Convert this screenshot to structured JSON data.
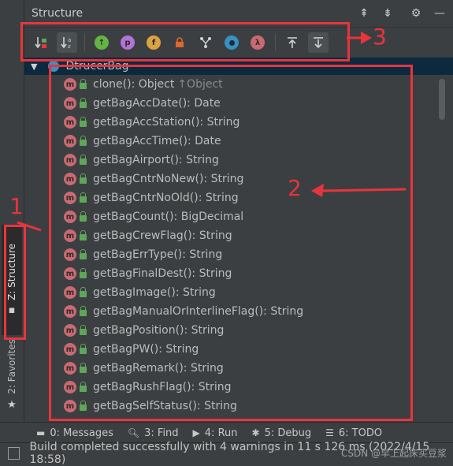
{
  "panel": {
    "title": "Structure",
    "root_label": "DtrucerBag"
  },
  "left_tabs": {
    "structure": "Z: Structure",
    "favorites": "2: Favorites"
  },
  "members": [
    {
      "name": "clone(): Object",
      "inherited": "↑Object"
    },
    {
      "name": "getBagAccDate(): Date"
    },
    {
      "name": "getBagAccStation(): String"
    },
    {
      "name": "getBagAccTime(): Date"
    },
    {
      "name": "getBagAirport(): String"
    },
    {
      "name": "getBagCntrNoNew(): String"
    },
    {
      "name": "getBagCntrNoOld(): String"
    },
    {
      "name": "getBagCount(): BigDecimal"
    },
    {
      "name": "getBagCrewFlag(): String"
    },
    {
      "name": "getBagErrType(): String"
    },
    {
      "name": "getBagFinalDest(): String"
    },
    {
      "name": "getBagImage(): String"
    },
    {
      "name": "getBagManualOrInterlineFlag(): String"
    },
    {
      "name": "getBagPosition(): String"
    },
    {
      "name": "getBagPW(): String"
    },
    {
      "name": "getBagRemark(): String"
    },
    {
      "name": "getBagRushFlag(): String"
    },
    {
      "name": "getBagSelfStatus(): String"
    }
  ],
  "annotations": {
    "one": "1",
    "two": "2",
    "three": "3"
  },
  "toolwindows": {
    "messages": "0: Messages",
    "find": "3: Find",
    "run": "4: Run",
    "debug": "5: Debug",
    "todo": "6: TODO"
  },
  "status": {
    "text": "Build completed successfully with 4 warnings in 11 s 126 ms (2022/4/15 18:58)"
  },
  "watermark": "CSDN @早上起床买豆浆",
  "colors": {
    "annotation": "#e8343d",
    "method_icon": "#c96a72",
    "lock": "#5fa65b",
    "selection": "#0d293e"
  }
}
